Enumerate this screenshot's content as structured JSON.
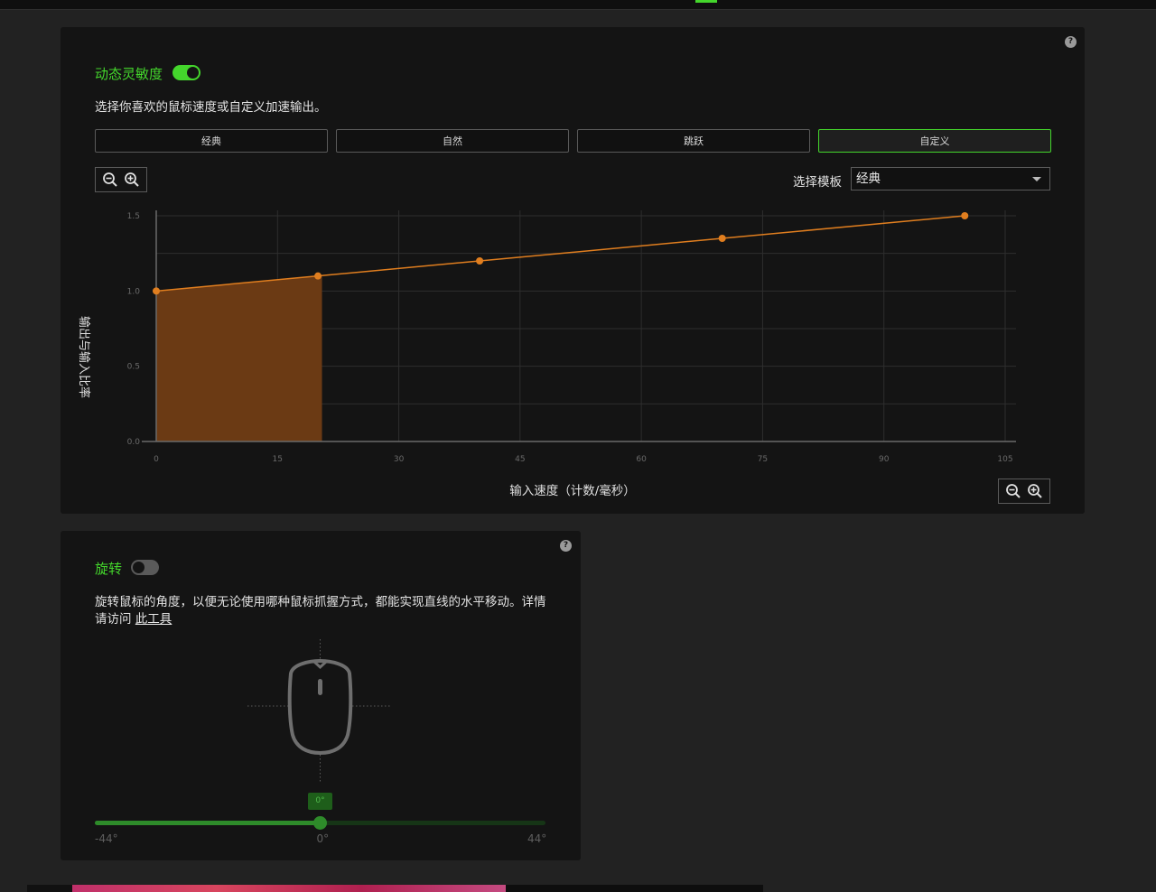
{
  "sensitivity": {
    "title": "动态灵敏度",
    "enabled": true,
    "description": "选择你喜欢的鼠标速度或自定义加速输出。",
    "presets": [
      "经典",
      "自然",
      "跳跃",
      "自定义"
    ],
    "active_preset": "自定义",
    "template_label": "选择模板",
    "template_value": "经典",
    "help": "?"
  },
  "chart_data": {
    "type": "line",
    "xlabel": "输入速度（计数/毫秒）",
    "ylabel": "输出与输入比率",
    "x_ticks": [
      "0",
      "15",
      "30",
      "45",
      "60",
      "75",
      "90",
      "105"
    ],
    "y_ticks": [
      "0.0",
      "0.5",
      "1.0",
      "1.5"
    ],
    "xlim": [
      0,
      105
    ],
    "ylim": [
      0,
      1.5
    ],
    "grid": true,
    "series": [
      {
        "x": [
          0,
          20,
          40,
          70,
          100
        ],
        "y": [
          1.0,
          1.1,
          1.2,
          1.35,
          1.5
        ]
      }
    ],
    "highlight_x": [
      0,
      20.5
    ],
    "colors": {
      "line": "#e07e1f",
      "fill": "#6b3a14"
    }
  },
  "rotation": {
    "title": "旋转",
    "enabled": false,
    "description": "旋转鼠标的角度，以便无论使用哪种鼠标抓握方式，都能实现直线的水平移动。详情请访问",
    "link_text": "此工具",
    "value_label": "0°",
    "value": 0,
    "min_label": "-44°",
    "max_label": "44°",
    "min": -44,
    "max": 44,
    "help": "?"
  },
  "colors": {
    "accent": "#44d62c",
    "background": "#222222",
    "card": "#141414"
  }
}
